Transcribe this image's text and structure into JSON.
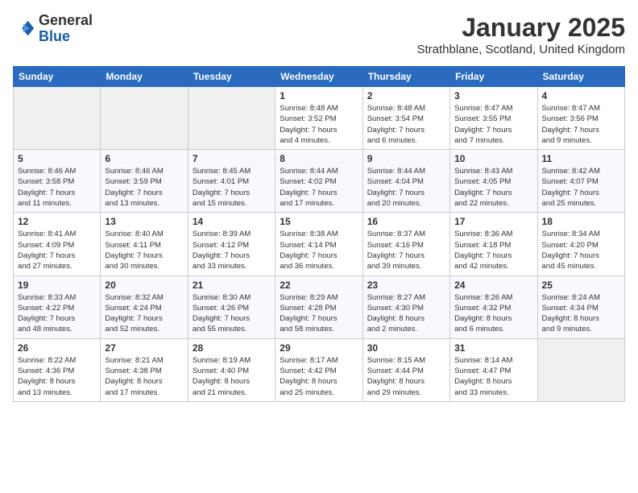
{
  "header": {
    "logo_general": "General",
    "logo_blue": "Blue",
    "month_title": "January 2025",
    "subtitle": "Strathblane, Scotland, United Kingdom"
  },
  "weekdays": [
    "Sunday",
    "Monday",
    "Tuesday",
    "Wednesday",
    "Thursday",
    "Friday",
    "Saturday"
  ],
  "weeks": [
    [
      {
        "day": "",
        "info": ""
      },
      {
        "day": "",
        "info": ""
      },
      {
        "day": "",
        "info": ""
      },
      {
        "day": "1",
        "info": "Sunrise: 8:48 AM\nSunset: 3:52 PM\nDaylight: 7 hours\nand 4 minutes."
      },
      {
        "day": "2",
        "info": "Sunrise: 8:48 AM\nSunset: 3:54 PM\nDaylight: 7 hours\nand 6 minutes."
      },
      {
        "day": "3",
        "info": "Sunrise: 8:47 AM\nSunset: 3:55 PM\nDaylight: 7 hours\nand 7 minutes."
      },
      {
        "day": "4",
        "info": "Sunrise: 8:47 AM\nSunset: 3:56 PM\nDaylight: 7 hours\nand 9 minutes."
      }
    ],
    [
      {
        "day": "5",
        "info": "Sunrise: 8:46 AM\nSunset: 3:58 PM\nDaylight: 7 hours\nand 11 minutes."
      },
      {
        "day": "6",
        "info": "Sunrise: 8:46 AM\nSunset: 3:59 PM\nDaylight: 7 hours\nand 13 minutes."
      },
      {
        "day": "7",
        "info": "Sunrise: 8:45 AM\nSunset: 4:01 PM\nDaylight: 7 hours\nand 15 minutes."
      },
      {
        "day": "8",
        "info": "Sunrise: 8:44 AM\nSunset: 4:02 PM\nDaylight: 7 hours\nand 17 minutes."
      },
      {
        "day": "9",
        "info": "Sunrise: 8:44 AM\nSunset: 4:04 PM\nDaylight: 7 hours\nand 20 minutes."
      },
      {
        "day": "10",
        "info": "Sunrise: 8:43 AM\nSunset: 4:05 PM\nDaylight: 7 hours\nand 22 minutes."
      },
      {
        "day": "11",
        "info": "Sunrise: 8:42 AM\nSunset: 4:07 PM\nDaylight: 7 hours\nand 25 minutes."
      }
    ],
    [
      {
        "day": "12",
        "info": "Sunrise: 8:41 AM\nSunset: 4:09 PM\nDaylight: 7 hours\nand 27 minutes."
      },
      {
        "day": "13",
        "info": "Sunrise: 8:40 AM\nSunset: 4:11 PM\nDaylight: 7 hours\nand 30 minutes."
      },
      {
        "day": "14",
        "info": "Sunrise: 8:39 AM\nSunset: 4:12 PM\nDaylight: 7 hours\nand 33 minutes."
      },
      {
        "day": "15",
        "info": "Sunrise: 8:38 AM\nSunset: 4:14 PM\nDaylight: 7 hours\nand 36 minutes."
      },
      {
        "day": "16",
        "info": "Sunrise: 8:37 AM\nSunset: 4:16 PM\nDaylight: 7 hours\nand 39 minutes."
      },
      {
        "day": "17",
        "info": "Sunrise: 8:36 AM\nSunset: 4:18 PM\nDaylight: 7 hours\nand 42 minutes."
      },
      {
        "day": "18",
        "info": "Sunrise: 8:34 AM\nSunset: 4:20 PM\nDaylight: 7 hours\nand 45 minutes."
      }
    ],
    [
      {
        "day": "19",
        "info": "Sunrise: 8:33 AM\nSunset: 4:22 PM\nDaylight: 7 hours\nand 48 minutes."
      },
      {
        "day": "20",
        "info": "Sunrise: 8:32 AM\nSunset: 4:24 PM\nDaylight: 7 hours\nand 52 minutes."
      },
      {
        "day": "21",
        "info": "Sunrise: 8:30 AM\nSunset: 4:26 PM\nDaylight: 7 hours\nand 55 minutes."
      },
      {
        "day": "22",
        "info": "Sunrise: 8:29 AM\nSunset: 4:28 PM\nDaylight: 7 hours\nand 58 minutes."
      },
      {
        "day": "23",
        "info": "Sunrise: 8:27 AM\nSunset: 4:30 PM\nDaylight: 8 hours\nand 2 minutes."
      },
      {
        "day": "24",
        "info": "Sunrise: 8:26 AM\nSunset: 4:32 PM\nDaylight: 8 hours\nand 6 minutes."
      },
      {
        "day": "25",
        "info": "Sunrise: 8:24 AM\nSunset: 4:34 PM\nDaylight: 8 hours\nand 9 minutes."
      }
    ],
    [
      {
        "day": "26",
        "info": "Sunrise: 8:22 AM\nSunset: 4:36 PM\nDaylight: 8 hours\nand 13 minutes."
      },
      {
        "day": "27",
        "info": "Sunrise: 8:21 AM\nSunset: 4:38 PM\nDaylight: 8 hours\nand 17 minutes."
      },
      {
        "day": "28",
        "info": "Sunrise: 8:19 AM\nSunset: 4:40 PM\nDaylight: 8 hours\nand 21 minutes."
      },
      {
        "day": "29",
        "info": "Sunrise: 8:17 AM\nSunset: 4:42 PM\nDaylight: 8 hours\nand 25 minutes."
      },
      {
        "day": "30",
        "info": "Sunrise: 8:15 AM\nSunset: 4:44 PM\nDaylight: 8 hours\nand 29 minutes."
      },
      {
        "day": "31",
        "info": "Sunrise: 8:14 AM\nSunset: 4:47 PM\nDaylight: 8 hours\nand 33 minutes."
      },
      {
        "day": "",
        "info": ""
      }
    ]
  ]
}
